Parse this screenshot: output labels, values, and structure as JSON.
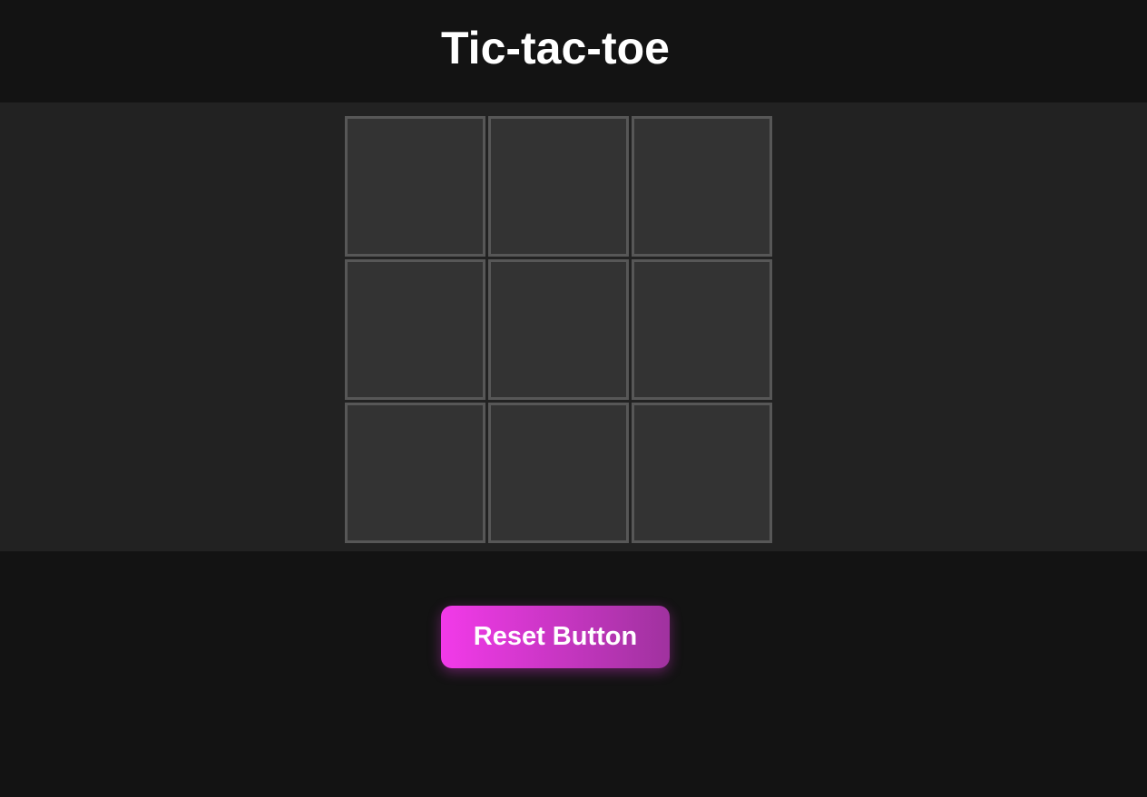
{
  "page": {
    "title": "Tic-tac-toe"
  },
  "board": {
    "rows": 3,
    "columns": 3,
    "cells": [
      "",
      "",
      "",
      "",
      "",
      "",
      "",
      "",
      ""
    ]
  },
  "controls": {
    "reset_label": "Reset Button"
  },
  "colors": {
    "background": "#131313",
    "board_band": "#222222",
    "cell_fill": "#333333",
    "cell_border": "#575757",
    "button_gradient_start": "#f23ae9",
    "button_gradient_end": "#a0329f",
    "text": "#ffffff"
  }
}
